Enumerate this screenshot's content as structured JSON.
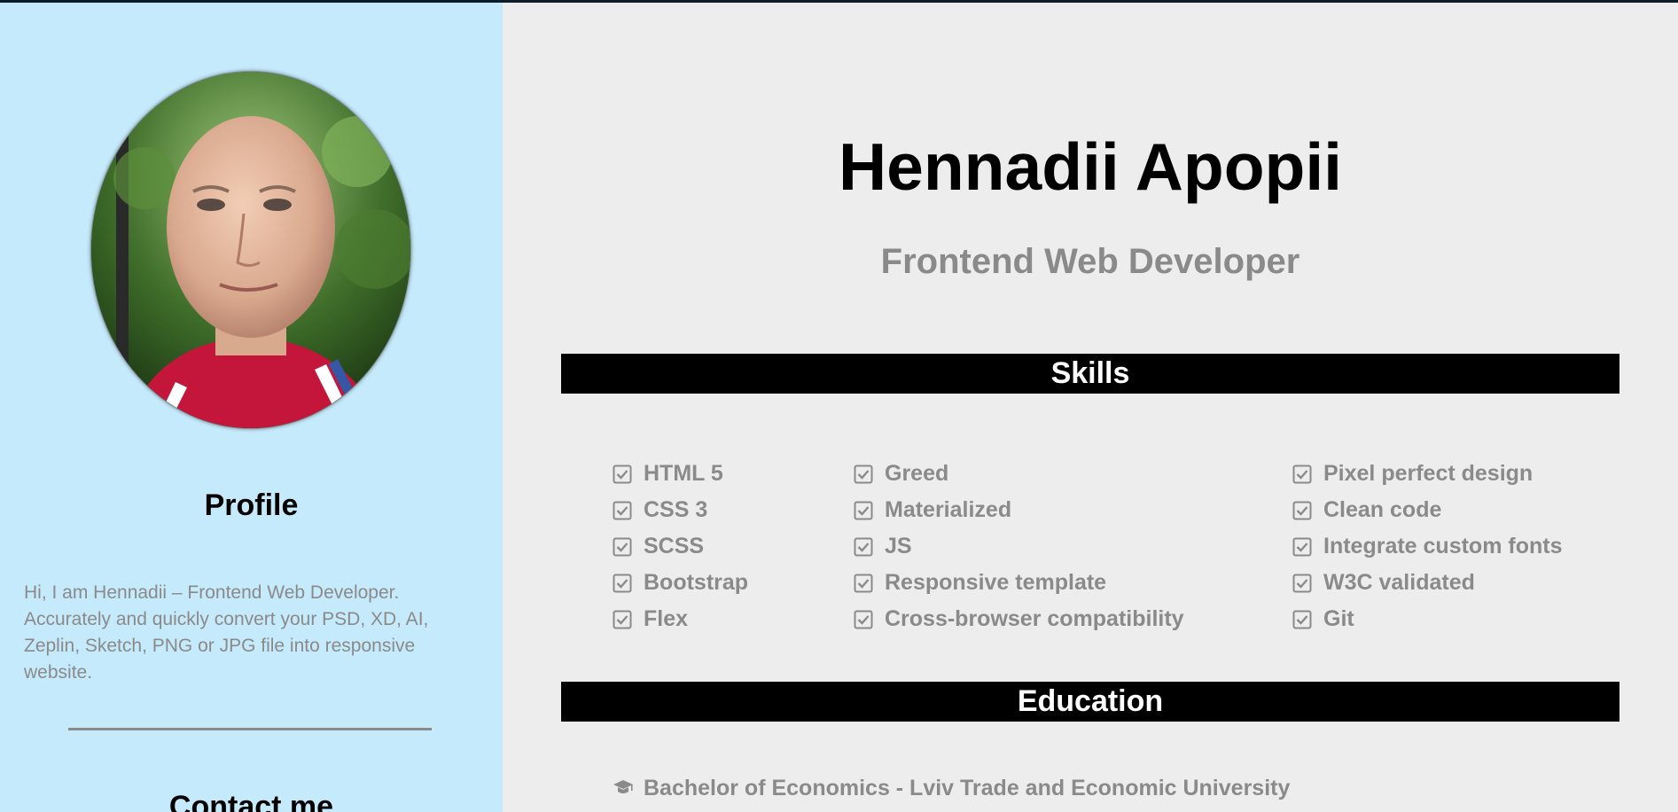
{
  "sidebar": {
    "profile_title": "Profile",
    "profile_text": "Hi, I am Hennadii – Frontend Web Developer. Accurately and quickly convert your PSD, XD, AI, Zeplin, Sketch, PNG or JPG file into responsive website.",
    "contact_title": "Contact me"
  },
  "header": {
    "name": "Hennadii Apopii",
    "job_title": "Frontend Web Developer"
  },
  "skills": {
    "title": "Skills",
    "columns": [
      [
        "HTML 5",
        "CSS 3",
        "SCSS",
        "Bootstrap",
        "Flex"
      ],
      [
        "Greed",
        "Materialized",
        "JS",
        "Responsive template",
        "Cross-browser compatibility"
      ],
      [
        "Pixel perfect design",
        "Clean code",
        "Integrate custom fonts",
        "W3C validated",
        "Git"
      ]
    ]
  },
  "education": {
    "title": "Education",
    "items": [
      "Bachelor of Economics - Lviv Trade and Economic University"
    ]
  },
  "icons": {
    "skill": "check-square-icon",
    "education": "graduation-cap-icon"
  },
  "colors": {
    "sidebar_bg": "#c5eafb",
    "main_bg": "#ededed",
    "muted_text": "#8a8a8a",
    "section_bar": "#000000"
  }
}
